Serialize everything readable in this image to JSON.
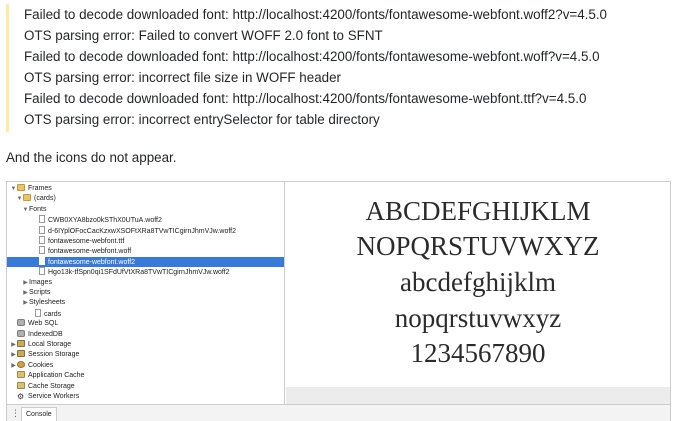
{
  "quote": {
    "lines": [
      "Failed to decode downloaded font: http://localhost:4200/fonts/fontawesome-webfont.woff2?v=4.5.0",
      "OTS parsing error: Failed to convert WOFF 2.0 font to SFNT",
      "Failed to decode downloaded font: http://localhost:4200/fonts/fontawesome-webfont.woff?v=4.5.0",
      "OTS parsing error: incorrect file size in WOFF header",
      "Failed to decode downloaded font: http://localhost:4200/fonts/fontawesome-webfont.ttf?v=4.5.0",
      "OTS parsing error: incorrect entrySelector for table directory"
    ]
  },
  "paragraph": "And the icons do not appear.",
  "devtools": {
    "tree": [
      {
        "label": "Frames",
        "arrow": "▼",
        "icon": "folder-icon"
      },
      {
        "label": "(cards)",
        "arrow": "▼",
        "icon": "folder-icon"
      },
      {
        "label": "Fonts",
        "arrow": "▼",
        "icon": ""
      },
      {
        "label": "CWB0XYA8bzo0kSThX0UTuA.woff2",
        "arrow": "",
        "icon": "file-icon"
      },
      {
        "label": "d-6IYplOFocCacKzxwXSOFtXRa8TVwTICgirnJhmVJw.woff2",
        "arrow": "",
        "icon": "file-icon"
      },
      {
        "label": "fontawesome-webfont.ttf",
        "arrow": "",
        "icon": "file-icon"
      },
      {
        "label": "fontawesome-webfont.woff",
        "arrow": "",
        "icon": "file-icon"
      },
      {
        "label": "fontawesome-webfont.woff2",
        "arrow": "",
        "icon": "file-icon",
        "selected": true
      },
      {
        "label": "Hgo13k-tfSpn0qi1SFdUfVtXRa8TVwTICgirnJhmVJw.woff2",
        "arrow": "",
        "icon": "file-icon"
      },
      {
        "label": "Images",
        "arrow": "▶",
        "icon": ""
      },
      {
        "label": "Scripts",
        "arrow": "▶",
        "icon": ""
      },
      {
        "label": "Stylesheets",
        "arrow": "▶",
        "icon": ""
      },
      {
        "label": "cards",
        "arrow": "",
        "icon": "file-icon"
      },
      {
        "label": "Web SQL",
        "arrow": "",
        "icon": "database-icon"
      },
      {
        "label": "IndexedDB",
        "arrow": "",
        "icon": "database-icon"
      },
      {
        "label": "Local Storage",
        "arrow": "▶",
        "icon": "grid-icon"
      },
      {
        "label": "Session Storage",
        "arrow": "▶",
        "icon": "grid-icon"
      },
      {
        "label": "Cookies",
        "arrow": "▶",
        "icon": "cookie-icon"
      },
      {
        "label": "Application Cache",
        "arrow": "",
        "icon": "cache-icon"
      },
      {
        "label": "Cache Storage",
        "arrow": "",
        "icon": "cache-icon"
      },
      {
        "label": "Service Workers",
        "arrow": "",
        "icon": "gear-icon"
      }
    ],
    "preview_lines": [
      "ABCDEFGHIJKLM",
      "NOPQRSTUVWXYZ",
      "abcdefghijklm",
      "nopqrstuvwxyz",
      "1234567890"
    ],
    "drawer_menu_glyph": "⋮",
    "console_tab": "Console"
  },
  "colors": {
    "quote_border": "#ffeaa1",
    "selection": "#3879d9",
    "text": "#242729"
  }
}
